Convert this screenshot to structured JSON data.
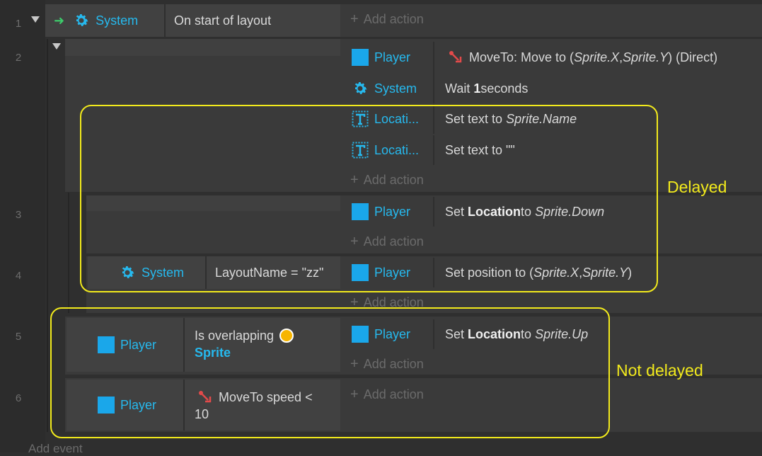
{
  "line_numbers": [
    "1",
    "2",
    "3",
    "4",
    "5",
    "6"
  ],
  "events": {
    "e1": {
      "condition_object": "System",
      "condition_text": "On start of layout",
      "add_action": "Add action"
    },
    "e2": {
      "actions": [
        {
          "object": "Player",
          "icon": "moveto-icon",
          "text_plain": "MoveTo: Move to (",
          "arg1": "Sprite.X",
          "sep": ", ",
          "arg2": "Sprite.Y",
          "tail": ") (Direct)"
        },
        {
          "object": "System",
          "icon": "gear-icon",
          "pre": "Wait ",
          "bold": "1",
          "post": " seconds"
        },
        {
          "object": "Locati...",
          "icon": "text-object-icon",
          "pre": "Set text to ",
          "ital": "Sprite.Name"
        },
        {
          "object": "Locati...",
          "icon": "text-object-icon",
          "pre": "Set text to \"\""
        }
      ],
      "add_action": "Add action"
    },
    "e3": {
      "actions": [
        {
          "object": "Player",
          "pre": "Set ",
          "bold": "Location",
          "mid": " to ",
          "ital": "Sprite.Down"
        }
      ],
      "add_action": "Add action"
    },
    "e4": {
      "condition_object": "System",
      "condition_text": "LayoutName = \"zz\"",
      "actions": [
        {
          "object": "Player",
          "pre": "Set position to (",
          "arg1": "Sprite.X",
          "sep": ", ",
          "arg2": "Sprite.Y",
          "post": ")"
        }
      ],
      "add_action": "Add action"
    },
    "e5": {
      "condition_object": "Player",
      "condition_text_line1": "Is overlapping",
      "condition_text_line2": "Sprite",
      "actions": [
        {
          "object": "Player",
          "pre": "Set ",
          "bold": "Location",
          "mid": " to ",
          "ital": "Sprite.Up"
        }
      ],
      "add_action": "Add action"
    },
    "e6": {
      "condition_object": "Player",
      "condition_text_line1": "MoveTo speed <",
      "condition_text_line2": "10",
      "add_action": "Add action"
    }
  },
  "annotations": {
    "delayed": "Delayed",
    "not_delayed": "Not delayed",
    "color": "#f2ea1c"
  },
  "footer": {
    "add_event": "Add event"
  },
  "colors": {
    "object_blue": "#26b9ee",
    "square_blue": "#1aa7ea",
    "background": "#2f2f2f"
  }
}
